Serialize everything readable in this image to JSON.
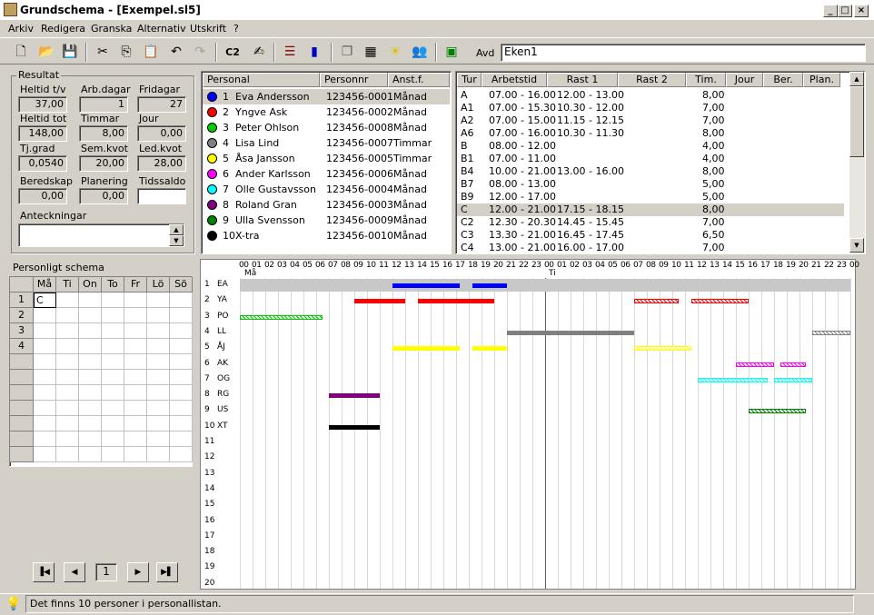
{
  "window": {
    "title": "Grundschema - [Exempel.sl5]"
  },
  "menu": [
    "Arkiv",
    "Redigera",
    "Granska",
    "Alternativ",
    "Utskrift",
    "?"
  ],
  "toolbar": {
    "c2_label": "C2",
    "avd_label": "Avd",
    "avd_value": "Eken1"
  },
  "resultat": {
    "title": "Resultat",
    "fields": [
      {
        "label": "Heltid t/v",
        "value": "37,00"
      },
      {
        "label": "Arb.dagar",
        "value": "1"
      },
      {
        "label": "Fridagar",
        "value": "27"
      },
      {
        "label": "Heltid tot",
        "value": "148,00"
      },
      {
        "label": "Timmar",
        "value": "8,00"
      },
      {
        "label": "Jour",
        "value": "0,00"
      },
      {
        "label": "Tj.grad",
        "value": "0,0540"
      },
      {
        "label": "Sem.kvot",
        "value": "20,00"
      },
      {
        "label": "Led.kvot",
        "value": "28,00"
      },
      {
        "label": "Beredskap",
        "value": "0,00"
      },
      {
        "label": "Planering",
        "value": "0,00"
      },
      {
        "label": "Tidssaldo",
        "value": ""
      }
    ],
    "notes_label": "Anteckningar"
  },
  "personal": {
    "headers": [
      "Personal",
      "Personnr",
      "Anst.f."
    ],
    "rows": [
      {
        "num": "1",
        "name": "Eva Andersson",
        "pnr": "123456-0001",
        "anst": "Månad",
        "color": "#0000ff"
      },
      {
        "num": "2",
        "name": "Yngve Ask",
        "pnr": "123456-0002",
        "anst": "Månad",
        "color": "#ff0000"
      },
      {
        "num": "3",
        "name": "Peter Ohlson",
        "pnr": "123456-0008",
        "anst": "Månad",
        "color": "#00cc00"
      },
      {
        "num": "4",
        "name": "Lisa Lind",
        "pnr": "123456-0007",
        "anst": "Timmar",
        "color": "#808080"
      },
      {
        "num": "5",
        "name": "Åsa Jansson",
        "pnr": "123456-0005",
        "anst": "Timmar",
        "color": "#ffff00"
      },
      {
        "num": "6",
        "name": "Ander Karlsson",
        "pnr": "123456-0006",
        "anst": "Månad",
        "color": "#ff00ff"
      },
      {
        "num": "7",
        "name": "Olle Gustavsson",
        "pnr": "123456-0004",
        "anst": "Månad",
        "color": "#00ffff"
      },
      {
        "num": "8",
        "name": "Roland Gran",
        "pnr": "123456-0003",
        "anst": "Månad",
        "color": "#800080"
      },
      {
        "num": "9",
        "name": "Ulla Svensson",
        "pnr": "123456-0009",
        "anst": "Månad",
        "color": "#008000"
      },
      {
        "num": "10",
        "name": "X-tra",
        "pnr": "123456-0010",
        "anst": "Månad",
        "color": "#000000"
      }
    ]
  },
  "turer": {
    "headers": [
      "Tur",
      "Arbetstid",
      "Rast 1",
      "Rast 2",
      "Tim.",
      "Jour",
      "Ber.",
      "Plan."
    ],
    "rows": [
      {
        "tur": "A",
        "arb": "07.00 - 16.00",
        "r1": "12.00 - 13.00",
        "r2": "",
        "tim": "8,00"
      },
      {
        "tur": "A1",
        "arb": "07.00 - 15.30",
        "r1": "10.30 - 12.00",
        "r2": "",
        "tim": "7,00"
      },
      {
        "tur": "A2",
        "arb": "07.00 - 15.00",
        "r1": "11.15 - 12.15",
        "r2": "",
        "tim": "7,00"
      },
      {
        "tur": "A6",
        "arb": "07.00 - 16.00",
        "r1": "10.30 - 11.30",
        "r2": "",
        "tim": "8,00"
      },
      {
        "tur": "B",
        "arb": "08.00 - 12.00",
        "r1": "",
        "r2": "",
        "tim": "4,00"
      },
      {
        "tur": "B1",
        "arb": "07.00 - 11.00",
        "r1": "",
        "r2": "",
        "tim": "4,00"
      },
      {
        "tur": "B4",
        "arb": "10.00 - 21.00",
        "r1": "13.00 - 16.00",
        "r2": "",
        "tim": "8,00"
      },
      {
        "tur": "B7",
        "arb": "08.00 - 13.00",
        "r1": "",
        "r2": "",
        "tim": "5,00"
      },
      {
        "tur": "B9",
        "arb": "12.00 - 17.00",
        "r1": "",
        "r2": "",
        "tim": "5,00"
      },
      {
        "tur": "C",
        "arb": "12.00 - 21.00",
        "r1": "17.15 - 18.15",
        "r2": "",
        "tim": "8,00"
      },
      {
        "tur": "C2",
        "arb": "12.30 - 20.30",
        "r1": "14.45 - 15.45",
        "r2": "",
        "tim": "7,00"
      },
      {
        "tur": "C3",
        "arb": "13.30 - 21.00",
        "r1": "16.45 - 17.45",
        "r2": "",
        "tim": "6,50"
      },
      {
        "tur": "C4",
        "arb": "13.00 - 21.00",
        "r1": "16.00 - 17.00",
        "r2": "",
        "tim": "7,00"
      }
    ]
  },
  "schema": {
    "title": "Personligt schema",
    "days": [
      "Må",
      "Ti",
      "On",
      "To",
      "Fr",
      "Lö",
      "Sö"
    ],
    "weeks": [
      "1",
      "2",
      "3",
      "4"
    ],
    "first_cell": "C",
    "page": "1"
  },
  "gantt": {
    "hours": [
      "00",
      "01",
      "02",
      "03",
      "04",
      "05",
      "06",
      "07",
      "08",
      "09",
      "10",
      "11",
      "12",
      "13",
      "14",
      "15",
      "16",
      "17",
      "18",
      "19",
      "20",
      "21",
      "22",
      "23",
      "00",
      "01",
      "02",
      "03",
      "04",
      "05",
      "06",
      "07",
      "08",
      "09",
      "10",
      "11",
      "12",
      "13",
      "14",
      "15",
      "16",
      "17",
      "18",
      "19",
      "20",
      "21",
      "22",
      "23",
      "00"
    ],
    "day_labels": [
      "Må",
      "Ti"
    ],
    "rows": [
      "1",
      "2",
      "3",
      "4",
      "5",
      "6",
      "7",
      "8",
      "9",
      "10",
      "11",
      "12",
      "13",
      "14",
      "15",
      "16",
      "17",
      "18",
      "19",
      "20"
    ],
    "initials": [
      "EA",
      "YA",
      "PO",
      "LL",
      "ÅJ",
      "AK",
      "OG",
      "RG",
      "US",
      "XT"
    ]
  },
  "status": "Det finns 10 personer i personallistan."
}
